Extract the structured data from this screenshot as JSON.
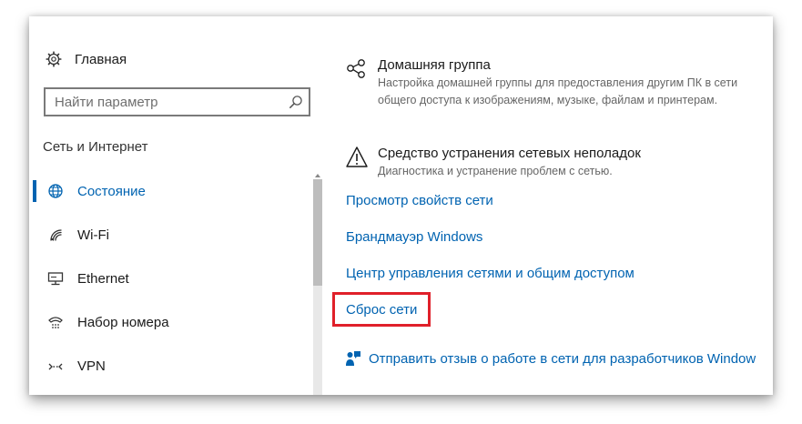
{
  "window": {
    "accent_color": "#0063b1",
    "highlight_color": "#e0202a"
  },
  "sidebar": {
    "home": {
      "icon": "gear-icon",
      "label": "Главная"
    },
    "search": {
      "placeholder": "Найти параметр",
      "icon": "search-icon"
    },
    "section_heading": "Сеть и Интернет",
    "items": [
      {
        "icon": "globe-icon",
        "label": "Состояние",
        "active": true
      },
      {
        "icon": "wifi-icon",
        "label": "Wi-Fi",
        "active": false
      },
      {
        "icon": "ethernet-icon",
        "label": "Ethernet",
        "active": false
      },
      {
        "icon": "dialup-icon",
        "label": "Набор номера",
        "active": false
      },
      {
        "icon": "vpn-icon",
        "label": "VPN",
        "active": false
      }
    ]
  },
  "main": {
    "homegroup": {
      "icon": "homegroup-icon",
      "title": "Домашняя группа",
      "description": "Настройка домашней группы для предоставления другим ПК в сети общего доступа к изображениям, музыке, файлам и принтерам."
    },
    "troubleshooter": {
      "icon": "warning-icon",
      "title": "Средство устранения сетевых неполадок",
      "description": "Диагностика и устранение проблем с сетью."
    },
    "links": [
      "Просмотр свойств сети",
      "Брандмауэр Windows",
      "Центр управления сетями и общим доступом",
      "Сброс сети"
    ],
    "feedback": {
      "icon": "feedback-icon",
      "label": "Отправить отзыв о работе в сети для разработчиков Window"
    }
  }
}
